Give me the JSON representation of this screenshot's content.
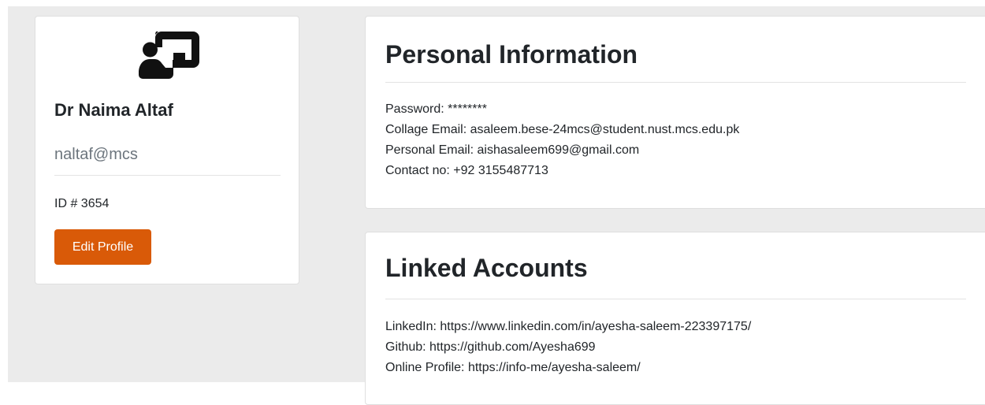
{
  "profile": {
    "icon": "teacher-presentation-icon",
    "name": "Dr Naima Altaf",
    "username": "naltaf@mcs",
    "id_text": "ID # 3654",
    "edit_button_label": "Edit Profile",
    "accent_color": "#d95a08"
  },
  "personal_info": {
    "title": "Personal Information",
    "lines": [
      "Password: ********",
      "Collage Email: asaleem.bese-24mcs@student.nust.mcs.edu.pk",
      "Personal Email: aishasaleem699@gmail.com",
      "Contact no: +92 3155487713"
    ]
  },
  "linked_accounts": {
    "title": "Linked Accounts",
    "lines": [
      "LinkedIn: https://www.linkedin.com/in/ayesha-saleem-223397175/",
      "Github: https://github.com/Ayesha699",
      "Online Profile: https://info-me/ayesha-saleem/"
    ]
  }
}
